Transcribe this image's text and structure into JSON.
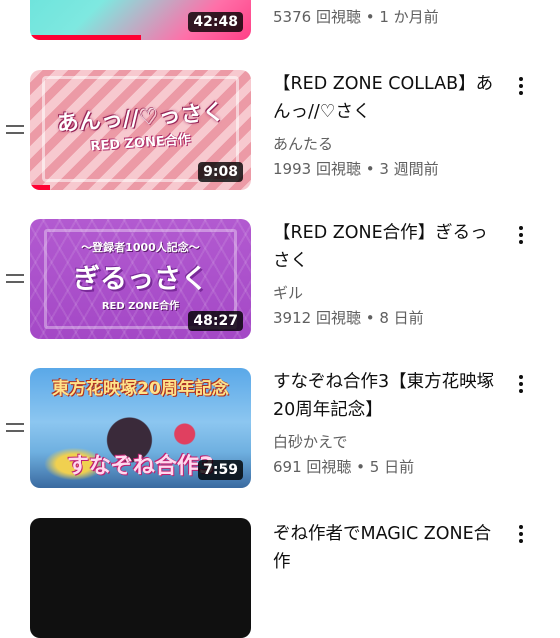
{
  "colors": {
    "progress_red": "#ff0033",
    "text_primary": "#0f0f0f",
    "text_secondary": "#606060"
  },
  "videos": [
    {
      "duration": "42:48",
      "meta": "5376 回視聴 • 1 か月前",
      "progress": 0.5,
      "thumb_art": {
        "style": "cyan-pink",
        "lines": []
      }
    },
    {
      "title": "【RED ZONE COLLAB】あんっ//♡さく",
      "channel": "あんたる",
      "meta": "1993 回視聴 • 3 週間前",
      "duration": "9:08",
      "progress": 0.09,
      "thumb_art": {
        "style": "pink-stripes",
        "lines": [
          "あんっ//♡っさく",
          "RED ZONE合作"
        ]
      }
    },
    {
      "title": "【RED ZONE合作】ぎるっさく",
      "channel": "ギル",
      "meta": "3912 回視聴 • 8 日前",
      "duration": "48:27",
      "progress": 0,
      "thumb_art": {
        "style": "purple-pattern",
        "lines": [
          "～登録者1000人記念～",
          "ぎるっさく",
          "RED ZONE合作"
        ]
      }
    },
    {
      "title": "すなぞね合作3【東方花映塚20周年記念】",
      "channel": "白砂かえで",
      "meta": "691 回視聴 • 5 日前",
      "duration": "7:59",
      "progress": 0,
      "thumb_art": {
        "style": "touhou-sky",
        "lines": [
          "東方花映塚20周年記念",
          "すなぞね合作3"
        ]
      }
    },
    {
      "title": "ぞね作者でMAGIC ZONE合作",
      "thumb_art": {
        "style": "dark",
        "lines": []
      }
    }
  ]
}
